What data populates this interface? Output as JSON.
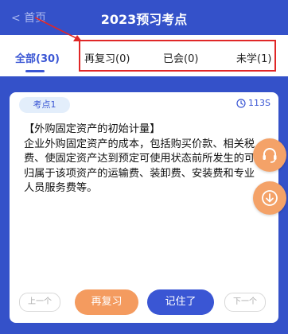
{
  "header": {
    "back_label": "< 首页",
    "title": "2023预习考点"
  },
  "tabs": [
    {
      "label": "全部(30)"
    },
    {
      "label": "再复习(0)"
    },
    {
      "label": "已会(0)"
    },
    {
      "label": "未学(1)"
    }
  ],
  "card": {
    "badge": "考点1",
    "timer": "113S",
    "content": "【外购固定资产的初始计量】\n企业外购固定资产的成本，包括购买价款、相关税费、使固定资产达到预定可使用状态前所发生的可归属于该项资产的运输费、装卸费、安装费和专业人员服务费等。"
  },
  "buttons": {
    "prev": "上一个",
    "review": "再复习",
    "remember": "记住了",
    "next": "下一个"
  },
  "floating": {
    "support_icon": "headset-icon",
    "download_icon": "download-icon"
  },
  "colors": {
    "primary": "#3451c9",
    "accent_orange": "#f49b5f",
    "highlight_red": "#e02727"
  }
}
